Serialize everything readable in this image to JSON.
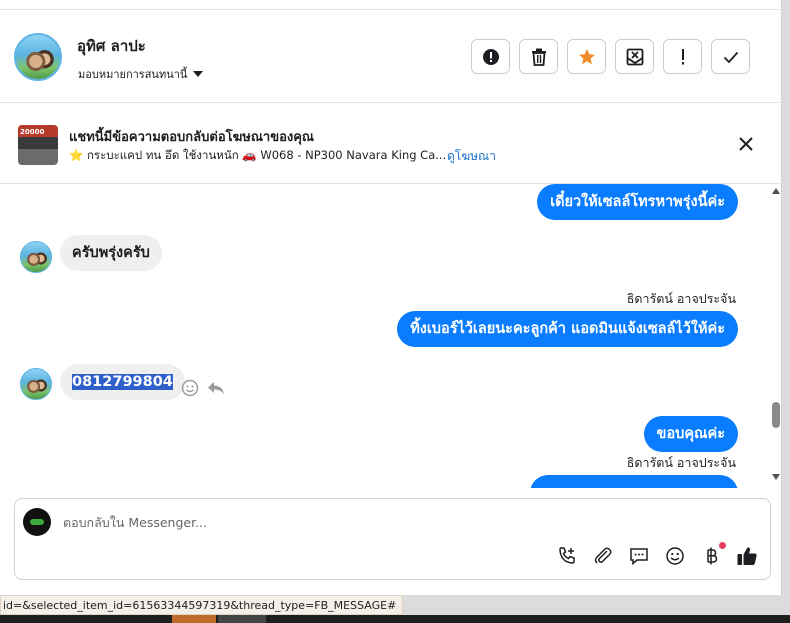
{
  "header": {
    "contact_name": "อุทิศ ลาปะ",
    "assign_label": "มอบหมายการสนทนานี้",
    "actions": [
      {
        "name": "report-button",
        "icon": "exclamation-circle-icon"
      },
      {
        "name": "delete-button",
        "icon": "trash-icon"
      },
      {
        "name": "star-button",
        "icon": "star-icon"
      },
      {
        "name": "mark-unread-button",
        "icon": "envelope-x-icon"
      },
      {
        "name": "important-button",
        "icon": "exclamation-icon"
      },
      {
        "name": "done-button",
        "icon": "check-icon"
      }
    ],
    "star_color": "#f08c2a"
  },
  "ad": {
    "thumb_text": "20000",
    "title": "แชทนี้มีข้อความตอบกลับต่อโฆษณาของคุณ",
    "subtitle": "⭐ กระบะแคป ทน อึด ใช้งานหนัก 🚗 W068 - NP300 Navara King Ca...",
    "view_ad_link": "ดูโฆษณา"
  },
  "messages": {
    "m1": "เดี๋ยวให้เซลล์โทรหาพรุ่งนี้ค่ะ",
    "m2": "ครับพรุ่งครับ",
    "sender1": "ธิดารัตน์ อาจประจัน",
    "m3": "ทิ้งเบอร์ไว้เลยนะคะลูกค้า แอดมินแจ้งเซลล์ไว้ให้ค่ะ",
    "m4": "0812799804",
    "m5": "ขอบคุณค่ะ",
    "sender2": "ธิดารัตน์ อาจประจัน"
  },
  "composer": {
    "placeholder": "ตอบกลับใน Messenger..."
  },
  "status_bar": {
    "url": "id=&selected_item_id=61563344597319&thread_type=FB_MESSAGE#"
  },
  "colors": {
    "outgoing_bubble": "#0a7cff",
    "incoming_bubble": "#efefef",
    "link": "#1a73c8"
  }
}
